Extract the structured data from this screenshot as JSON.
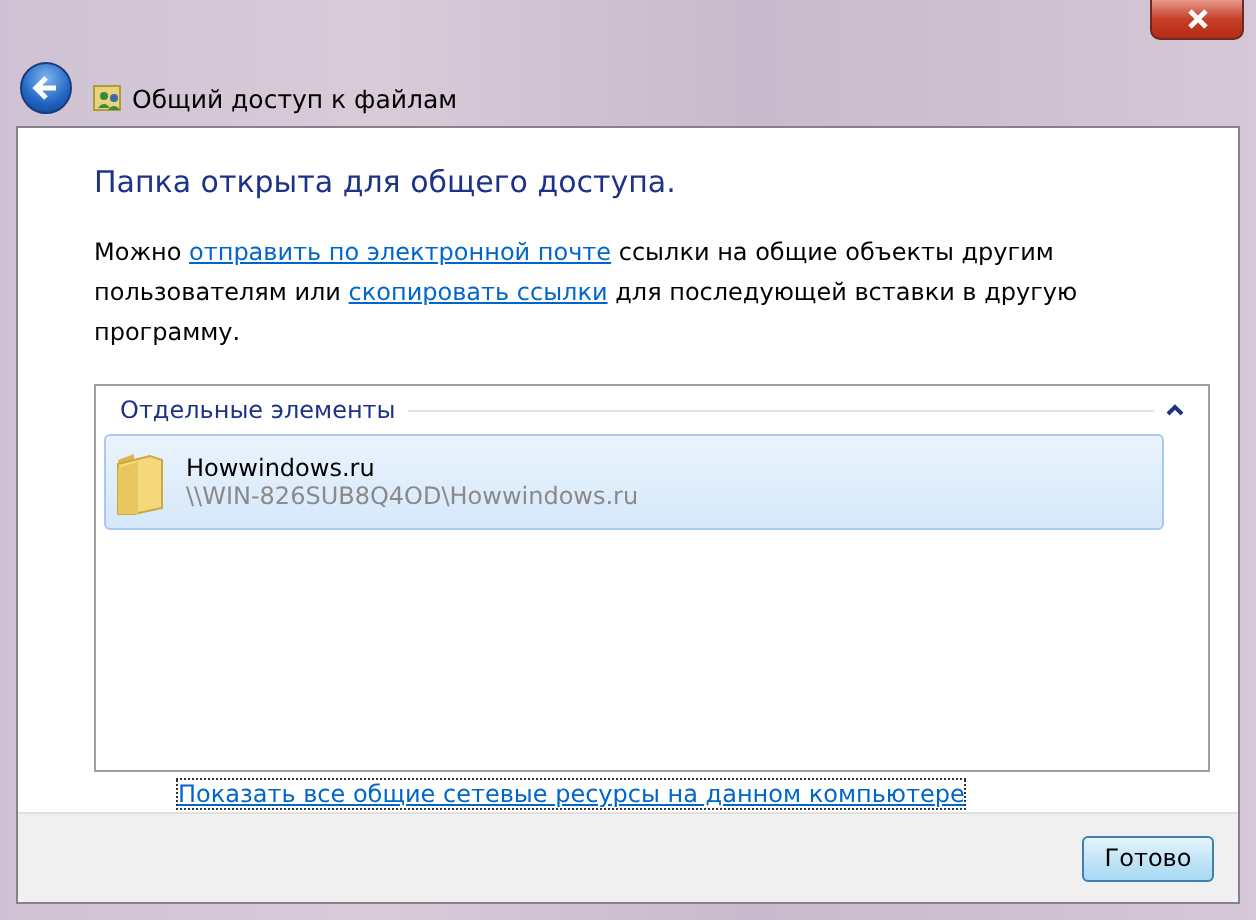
{
  "window": {
    "title": "Общий доступ к файлам"
  },
  "heading": "Папка открыта для общего доступа.",
  "description": [
    {
      "kind": "text",
      "text": "Можно "
    },
    {
      "kind": "link",
      "text": "отправить по электронной почте"
    },
    {
      "kind": "text",
      "text": " ссылки на общие объекты другим пользователям или "
    },
    {
      "kind": "link",
      "text": "скопировать ссылки"
    },
    {
      "kind": "text",
      "text": " для последующей вставки в другую программу."
    }
  ],
  "group": {
    "title": "Отдельные элементы",
    "expanded": true,
    "items": [
      {
        "name": "Howwindows.ru",
        "path": "\\\\WIN-826SUB8Q4OD\\Howwindows.ru",
        "selected": true
      }
    ]
  },
  "show_all_link": "Показать все общие сетевые ресурсы на данном компьютере",
  "buttons": [
    "Готово"
  ]
}
